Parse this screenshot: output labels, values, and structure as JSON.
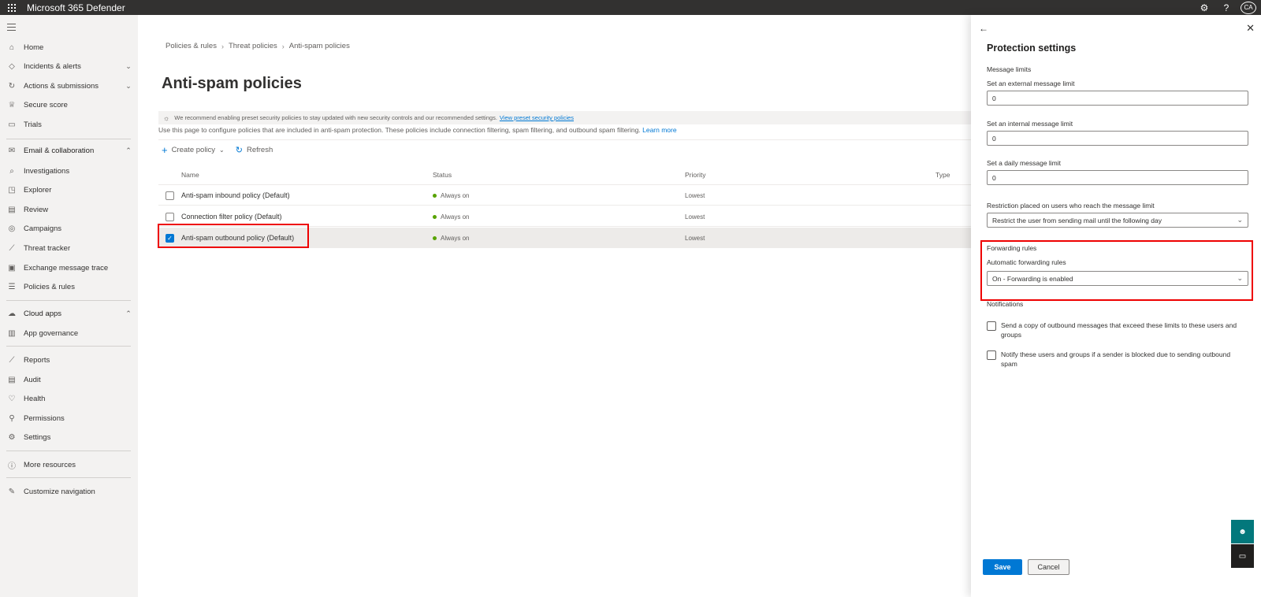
{
  "app": {
    "title": "Microsoft 365 Defender",
    "avatar_initials": "CA"
  },
  "topbar": {
    "settings_icon": "gear-icon",
    "help_label": "?"
  },
  "sidebar": {
    "items": [
      {
        "label": "Home",
        "icon": "home-icon"
      },
      {
        "label": "Incidents & alerts",
        "icon": "shield-icon"
      },
      {
        "label": "Actions & submissions",
        "icon": "actions-icon"
      },
      {
        "label": "Secure score",
        "icon": "trophy-icon"
      },
      {
        "label": "Trials",
        "icon": "trials-icon"
      },
      {
        "label": "Email & collaboration",
        "icon": "mail-icon"
      },
      {
        "label": "Investigations",
        "icon": "investigations-icon"
      },
      {
        "label": "Explorer",
        "icon": "explorer-icon"
      },
      {
        "label": "Review",
        "icon": "review-icon"
      },
      {
        "label": "Campaigns",
        "icon": "campaigns-icon"
      },
      {
        "label": "Threat tracker",
        "icon": "threat-tracker-icon"
      },
      {
        "label": "Exchange message trace",
        "icon": "exchange-icon"
      },
      {
        "label": "Policies & rules",
        "icon": "policies-icon"
      },
      {
        "label": "Cloud apps",
        "icon": "cloud-icon"
      },
      {
        "label": "App governance",
        "icon": "app-governance-icon"
      },
      {
        "label": "Reports",
        "icon": "reports-icon"
      },
      {
        "label": "Audit",
        "icon": "audit-icon"
      },
      {
        "label": "Health",
        "icon": "health-icon"
      },
      {
        "label": "Permissions",
        "icon": "permissions-icon"
      },
      {
        "label": "Settings",
        "icon": "settings-icon"
      },
      {
        "label": "More resources",
        "icon": "info-icon"
      },
      {
        "label": "Customize navigation",
        "icon": "pencil-icon"
      }
    ]
  },
  "main": {
    "breadcrumb": [
      "Policies & rules",
      "Threat policies",
      "Anti-spam policies"
    ],
    "title": "Anti-spam policies",
    "recommendation": "We recommend enabling preset security policies to stay updated with new security controls and our recommended settings.",
    "recommendation_link": "View preset security policies",
    "description": "Use this page to configure policies that are included in anti-spam protection. These policies include connection filtering, spam filtering, and outbound spam filtering.",
    "description_link": "Learn more",
    "commands": {
      "create": "Create policy",
      "refresh": "Refresh"
    },
    "columns": [
      "Name",
      "Status",
      "Priority",
      "Type"
    ],
    "rows": [
      {
        "name": "Anti-spam inbound policy (Default)",
        "status": "Always on",
        "priority": "Lowest",
        "selected": false
      },
      {
        "name": "Connection filter policy (Default)",
        "status": "Always on",
        "priority": "Lowest",
        "selected": false
      },
      {
        "name": "Anti-spam outbound policy (Default)",
        "status": "Always on",
        "priority": "Lowest",
        "selected": true
      }
    ]
  },
  "panel": {
    "title": "Protection settings",
    "message_limits_heading": "Message limits",
    "external_limit_label": "Set an external message limit",
    "external_limit_value": "0",
    "internal_limit_label": "Set an internal message limit",
    "internal_limit_value": "0",
    "daily_limit_label": "Set a daily message limit",
    "daily_limit_value": "0",
    "restriction_label": "Restriction placed on users who reach the message limit",
    "restriction_value": "Restrict the user from sending mail until the following day",
    "forwarding_heading": "Forwarding rules",
    "forwarding_label": "Automatic forwarding rules",
    "forwarding_value": "On - Forwarding is enabled",
    "notifications_heading": "Notifications",
    "notify_copy": "Send a copy of outbound messages that exceed these limits to these users and groups",
    "notify_blocked": "Notify these users and groups if a sender is blocked due to sending outbound spam",
    "save_label": "Save",
    "cancel_label": "Cancel"
  }
}
